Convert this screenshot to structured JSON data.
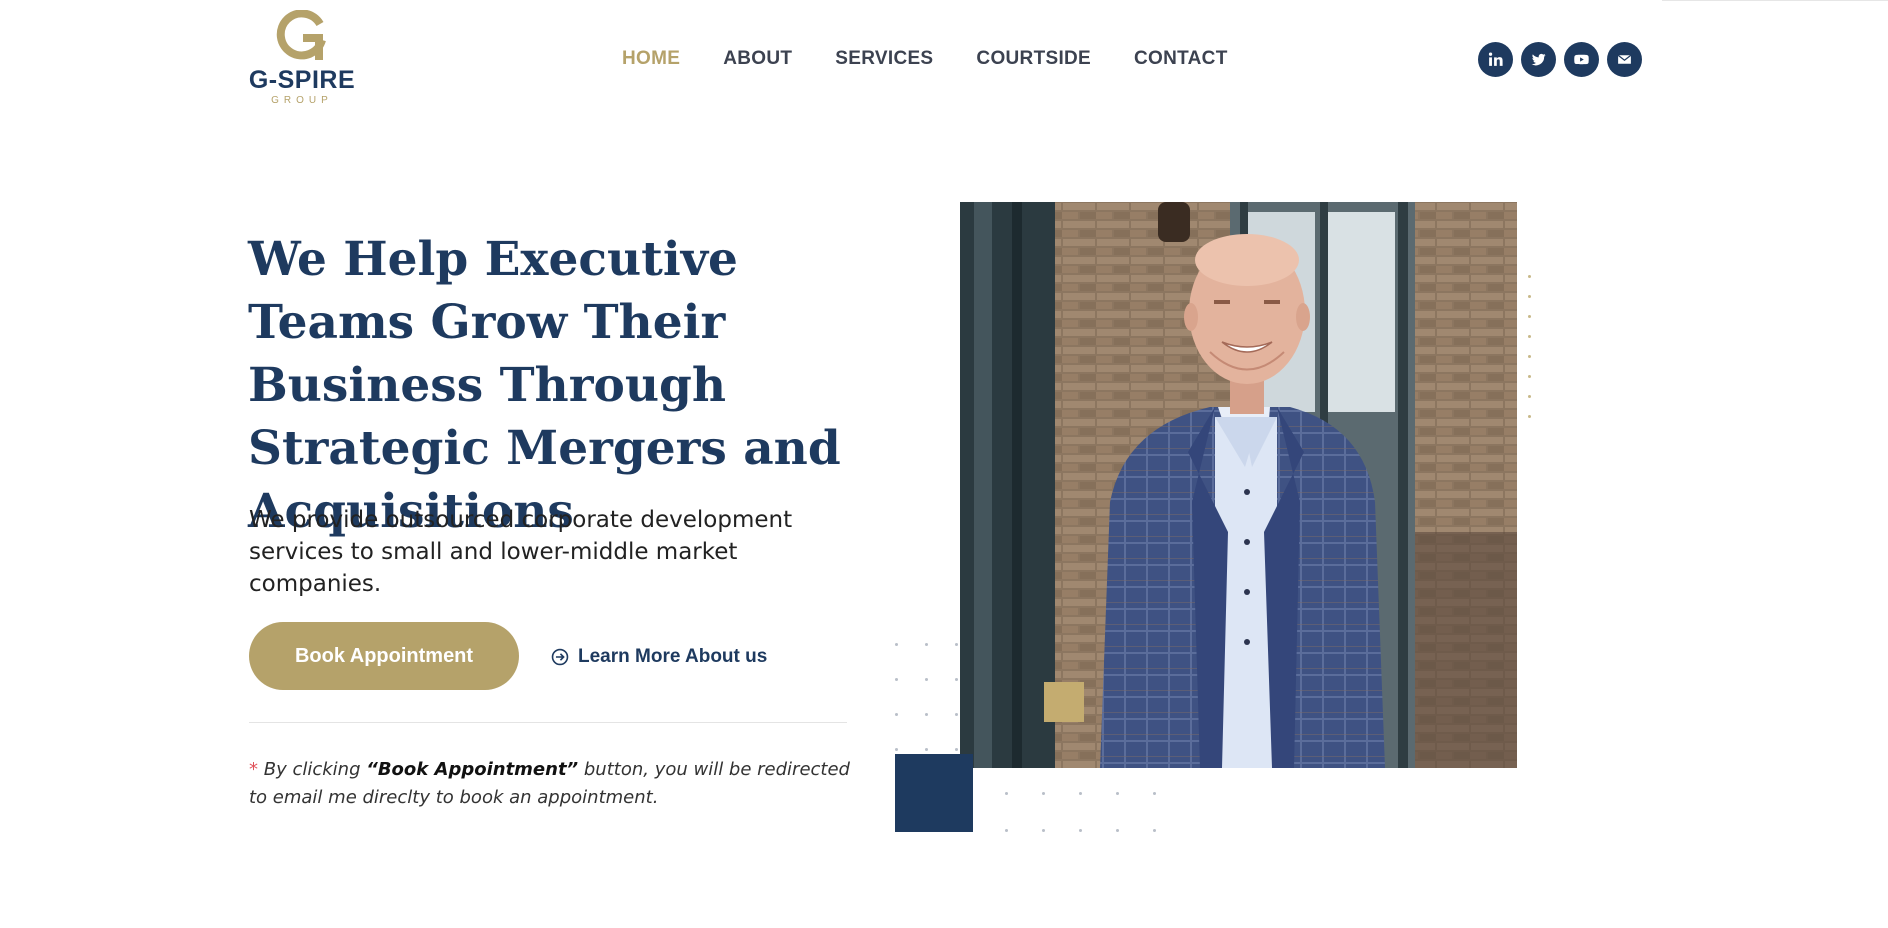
{
  "brand": {
    "name": "G-SPIRE",
    "sub": "GROUP",
    "colors": {
      "navy": "#1e3a5f",
      "gold": "#b5a26a"
    }
  },
  "nav": {
    "items": [
      {
        "label": "HOME",
        "active": true
      },
      {
        "label": "ABOUT",
        "active": false
      },
      {
        "label": "SERVICES",
        "active": false
      },
      {
        "label": "COURTSIDE",
        "active": false
      },
      {
        "label": "CONTACT",
        "active": false
      }
    ]
  },
  "social": [
    "linkedin-icon",
    "twitter-icon",
    "youtube-icon",
    "email-icon"
  ],
  "hero": {
    "headline": "We Help Executive Teams Grow Their Business Through Strategic Mergers and Acquisitions",
    "subtext": "We provide outsourced corporate development services to small and lower-middle market companies.",
    "book_button": "Book Appointment",
    "learn_more": "Learn More About us",
    "note_star": "*",
    "note_pre": " By clicking ",
    "note_bold": "“Book Appointment”",
    "note_post": " button, you will be redirected to email me direclty to book an appointment."
  }
}
